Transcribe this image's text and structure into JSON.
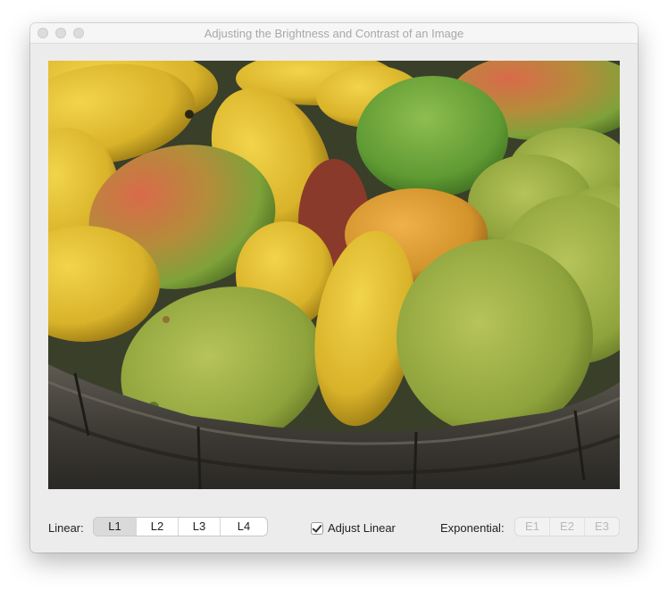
{
  "window": {
    "title": "Adjusting the Brightness and Contrast of an Image"
  },
  "image": {
    "subject": "mangoes-in-basket-photo"
  },
  "controls": {
    "linear_label": "Linear:",
    "linear_segments": [
      "L1",
      "L2",
      "L3",
      "L4"
    ],
    "linear_selected": "L1",
    "adjust_linear_label": "Adjust Linear",
    "adjust_linear_checked": true,
    "exponential_label": "Exponential:",
    "exponential_segments": [
      "E1",
      "E2",
      "E3"
    ],
    "exponential_enabled": false
  },
  "colors": {
    "window_bg": "#ececec",
    "selected_segment": "#dadada",
    "disabled_text": "#b9b9b9"
  }
}
